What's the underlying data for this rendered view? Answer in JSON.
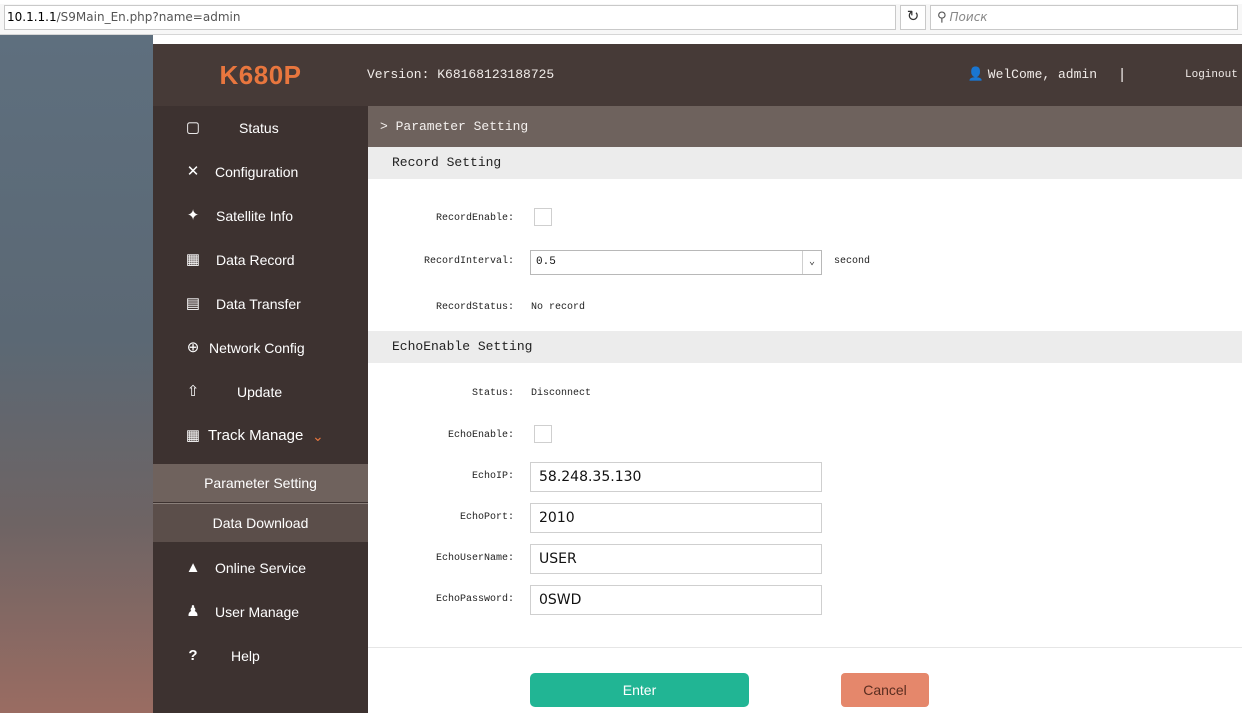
{
  "browser": {
    "url_host": "10.1.1.1",
    "url_path": "/S9Main_En.php?name=admin",
    "search_placeholder": "Поиск"
  },
  "header": {
    "logo": "K680P",
    "version": "Version: K68168123188725",
    "welcome": "WelCome, admin",
    "separator": "|",
    "logout": "Loginout"
  },
  "sidebar": {
    "items": [
      {
        "label": "Status",
        "icon": "monitor-icon"
      },
      {
        "label": "Configuration",
        "icon": "wrench-icon"
      },
      {
        "label": "Satellite Info",
        "icon": "satellite-icon"
      },
      {
        "label": "Data Record",
        "icon": "calendar-icon"
      },
      {
        "label": "Data Transfer",
        "icon": "network-icon"
      },
      {
        "label": "Network Config",
        "icon": "globe-icon"
      },
      {
        "label": "Update",
        "icon": "upload-icon"
      },
      {
        "label": "Track Manage",
        "icon": "calendar-icon"
      },
      {
        "label": "Online Service",
        "icon": "cube-icon"
      },
      {
        "label": "User Manage",
        "icon": "users-icon"
      },
      {
        "label": "Help",
        "icon": "question-icon"
      }
    ],
    "subitems": [
      {
        "label": "Parameter Setting",
        "active": true
      },
      {
        "label": "Data Download",
        "active": false
      }
    ]
  },
  "main": {
    "breadcrumb": "> Parameter Setting",
    "record_section": {
      "title": "Record Setting",
      "record_enable_label": "RecordEnable:",
      "record_interval_label": "RecordInterval:",
      "record_interval_value": "0.5",
      "record_interval_unit": "second",
      "record_status_label": "RecordStatus:",
      "record_status_value": "No record"
    },
    "echo_section": {
      "title": "EchoEnable Setting",
      "status_label": "Status:",
      "status_value": "Disconnect",
      "echo_enable_label": "EchoEnable:",
      "echo_ip_label": "EchoIP:",
      "echo_ip_value": "58.248.35.130",
      "echo_port_label": "EchoPort:",
      "echo_port_value": "2010",
      "echo_user_label": "EchoUserName:",
      "echo_user_value": "USER",
      "echo_password_label": "EchoPassword:",
      "echo_password_value": "0SWD"
    },
    "buttons": {
      "enter": "Enter",
      "cancel": "Cancel"
    }
  },
  "colors": {
    "header_bg": "#463a37",
    "sidebar_bg": "#3d3230",
    "logo": "#e8763e",
    "enter_button": "#21b594",
    "cancel_button": "#e5876b"
  }
}
